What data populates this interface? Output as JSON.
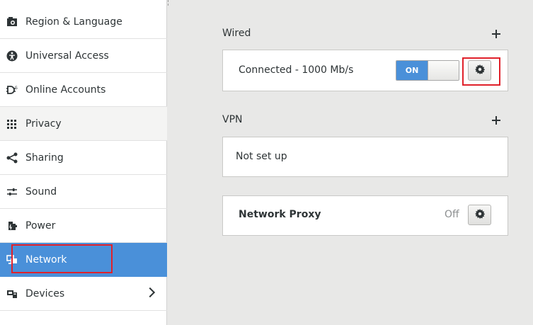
{
  "sidebar": {
    "items": [
      {
        "label": "Region & Language",
        "icon": "region-icon"
      },
      {
        "label": "Universal Access",
        "icon": "accessibility-icon"
      },
      {
        "label": "Online Accounts",
        "icon": "online-accounts-icon"
      },
      {
        "label": "Privacy",
        "icon": "privacy-icon"
      },
      {
        "label": "Sharing",
        "icon": "share-icon"
      },
      {
        "label": "Sound",
        "icon": "sound-icon"
      },
      {
        "label": "Power",
        "icon": "power-icon"
      },
      {
        "label": "Network",
        "icon": "network-icon",
        "selected": true
      },
      {
        "label": "Devices",
        "icon": "devices-icon"
      }
    ]
  },
  "wired": {
    "title": "Wired",
    "status": "Connected - 1000 Mb/s",
    "switch_label": "ON"
  },
  "vpn": {
    "title": "VPN",
    "status": "Not set up"
  },
  "proxy": {
    "title": "Network Proxy",
    "state": "Off"
  },
  "colors": {
    "accent": "#4a90d9",
    "highlight": "#e0212b"
  }
}
